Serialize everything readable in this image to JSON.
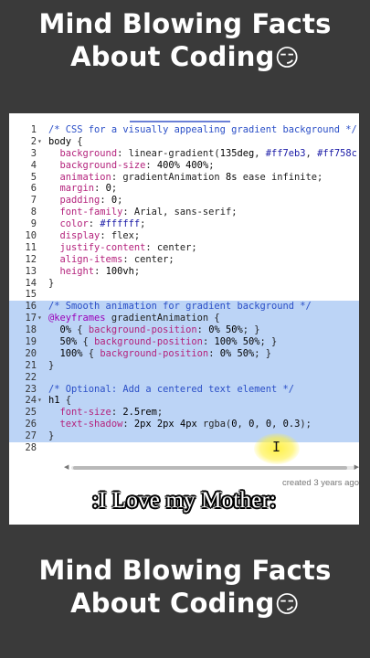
{
  "header": {
    "title_line1": "Mind Blowing Facts",
    "title_line2": "About Coding",
    "emoji": "😏"
  },
  "footer": {
    "title_line1": "Mind Blowing Facts",
    "title_line2": "About Coding",
    "emoji": "😏"
  },
  "editor": {
    "lines": [
      {
        "n": "1",
        "fold": "",
        "sel": false,
        "parts": [
          [
            "c-comment",
            "/* CSS for a visually appealing gradient background */"
          ]
        ]
      },
      {
        "n": "2",
        "fold": "▾",
        "sel": false,
        "parts": [
          [
            "c-sel",
            "body"
          ],
          [
            "c-punc",
            " {"
          ]
        ]
      },
      {
        "n": "3",
        "fold": "",
        "sel": false,
        "parts": [
          [
            "c-punc",
            "  "
          ],
          [
            "c-prop",
            "background"
          ],
          [
            "c-punc",
            ": linear-gradient("
          ],
          [
            "c-num",
            "135deg"
          ],
          [
            "c-punc",
            ", "
          ],
          [
            "c-str",
            "#ff7eb3"
          ],
          [
            "c-punc",
            ", "
          ],
          [
            "c-str",
            "#ff758c"
          ],
          [
            "c-punc",
            ","
          ]
        ]
      },
      {
        "n": "4",
        "fold": "",
        "sel": false,
        "parts": [
          [
            "c-punc",
            "  "
          ],
          [
            "c-prop",
            "background-size"
          ],
          [
            "c-punc",
            ": "
          ],
          [
            "c-num",
            "400%"
          ],
          [
            "c-punc",
            " "
          ],
          [
            "c-num",
            "400%"
          ],
          [
            "c-punc",
            ";"
          ]
        ]
      },
      {
        "n": "5",
        "fold": "",
        "sel": false,
        "parts": [
          [
            "c-punc",
            "  "
          ],
          [
            "c-prop",
            "animation"
          ],
          [
            "c-punc",
            ": gradientAnimation "
          ],
          [
            "c-num",
            "8s"
          ],
          [
            "c-punc",
            " ease infinite;"
          ]
        ]
      },
      {
        "n": "6",
        "fold": "",
        "sel": false,
        "parts": [
          [
            "c-punc",
            "  "
          ],
          [
            "c-prop",
            "margin"
          ],
          [
            "c-punc",
            ": "
          ],
          [
            "c-num",
            "0"
          ],
          [
            "c-punc",
            ";"
          ]
        ]
      },
      {
        "n": "7",
        "fold": "",
        "sel": false,
        "parts": [
          [
            "c-punc",
            "  "
          ],
          [
            "c-prop",
            "padding"
          ],
          [
            "c-punc",
            ": "
          ],
          [
            "c-num",
            "0"
          ],
          [
            "c-punc",
            ";"
          ]
        ]
      },
      {
        "n": "8",
        "fold": "",
        "sel": false,
        "parts": [
          [
            "c-punc",
            "  "
          ],
          [
            "c-prop",
            "font-family"
          ],
          [
            "c-punc",
            ": Arial, sans-serif;"
          ]
        ]
      },
      {
        "n": "9",
        "fold": "",
        "sel": false,
        "parts": [
          [
            "c-punc",
            "  "
          ],
          [
            "c-prop",
            "color"
          ],
          [
            "c-punc",
            ": "
          ],
          [
            "c-str",
            "#ffffff"
          ],
          [
            "c-punc",
            ";"
          ]
        ]
      },
      {
        "n": "10",
        "fold": "",
        "sel": false,
        "parts": [
          [
            "c-punc",
            "  "
          ],
          [
            "c-prop",
            "display"
          ],
          [
            "c-punc",
            ": flex;"
          ]
        ]
      },
      {
        "n": "11",
        "fold": "",
        "sel": false,
        "parts": [
          [
            "c-punc",
            "  "
          ],
          [
            "c-prop",
            "justify-content"
          ],
          [
            "c-punc",
            ": center;"
          ]
        ]
      },
      {
        "n": "12",
        "fold": "",
        "sel": false,
        "parts": [
          [
            "c-punc",
            "  "
          ],
          [
            "c-prop",
            "align-items"
          ],
          [
            "c-punc",
            ": center;"
          ]
        ]
      },
      {
        "n": "13",
        "fold": "",
        "sel": false,
        "parts": [
          [
            "c-punc",
            "  "
          ],
          [
            "c-prop",
            "height"
          ],
          [
            "c-punc",
            ": "
          ],
          [
            "c-num",
            "100vh"
          ],
          [
            "c-punc",
            ";"
          ]
        ]
      },
      {
        "n": "14",
        "fold": "",
        "sel": false,
        "parts": [
          [
            "c-punc",
            "}"
          ]
        ]
      },
      {
        "n": "15",
        "fold": "",
        "sel": false,
        "parts": []
      },
      {
        "n": "16",
        "fold": "",
        "sel": true,
        "parts": [
          [
            "c-comment",
            "/* Smooth animation for gradient background */"
          ]
        ]
      },
      {
        "n": "17",
        "fold": "▾",
        "sel": true,
        "parts": [
          [
            "c-kw",
            "@keyframes"
          ],
          [
            "c-punc",
            " gradientAnimation {"
          ]
        ]
      },
      {
        "n": "18",
        "fold": "",
        "sel": true,
        "parts": [
          [
            "c-punc",
            "  "
          ],
          [
            "c-num",
            "0%"
          ],
          [
            "c-punc",
            " { "
          ],
          [
            "c-prop",
            "background-position"
          ],
          [
            "c-punc",
            ": "
          ],
          [
            "c-num",
            "0%"
          ],
          [
            "c-punc",
            " "
          ],
          [
            "c-num",
            "50%"
          ],
          [
            "c-punc",
            "; }"
          ]
        ]
      },
      {
        "n": "19",
        "fold": "",
        "sel": true,
        "parts": [
          [
            "c-punc",
            "  "
          ],
          [
            "c-num",
            "50%"
          ],
          [
            "c-punc",
            " { "
          ],
          [
            "c-prop",
            "background-position"
          ],
          [
            "c-punc",
            ": "
          ],
          [
            "c-num",
            "100%"
          ],
          [
            "c-punc",
            " "
          ],
          [
            "c-num",
            "50%"
          ],
          [
            "c-punc",
            "; }"
          ]
        ]
      },
      {
        "n": "20",
        "fold": "",
        "sel": true,
        "parts": [
          [
            "c-punc",
            "  "
          ],
          [
            "c-num",
            "100%"
          ],
          [
            "c-punc",
            " { "
          ],
          [
            "c-prop",
            "background-position"
          ],
          [
            "c-punc",
            ": "
          ],
          [
            "c-num",
            "0%"
          ],
          [
            "c-punc",
            " "
          ],
          [
            "c-num",
            "50%"
          ],
          [
            "c-punc",
            "; }"
          ]
        ]
      },
      {
        "n": "21",
        "fold": "",
        "sel": true,
        "parts": [
          [
            "c-punc",
            "}"
          ]
        ]
      },
      {
        "n": "22",
        "fold": "",
        "sel": true,
        "parts": []
      },
      {
        "n": "23",
        "fold": "",
        "sel": true,
        "parts": [
          [
            "c-comment",
            "/* Optional: Add a centered text element */"
          ]
        ]
      },
      {
        "n": "24",
        "fold": "▾",
        "sel": true,
        "parts": [
          [
            "c-sel",
            "h1"
          ],
          [
            "c-punc",
            " {"
          ]
        ]
      },
      {
        "n": "25",
        "fold": "",
        "sel": true,
        "parts": [
          [
            "c-punc",
            "  "
          ],
          [
            "c-prop",
            "font-size"
          ],
          [
            "c-punc",
            ": "
          ],
          [
            "c-num",
            "2.5rem"
          ],
          [
            "c-punc",
            ";"
          ]
        ]
      },
      {
        "n": "26",
        "fold": "",
        "sel": true,
        "parts": [
          [
            "c-punc",
            "  "
          ],
          [
            "c-prop",
            "text-shadow"
          ],
          [
            "c-punc",
            ": "
          ],
          [
            "c-num",
            "2px"
          ],
          [
            "c-punc",
            " "
          ],
          [
            "c-num",
            "2px"
          ],
          [
            "c-punc",
            " "
          ],
          [
            "c-num",
            "4px"
          ],
          [
            "c-punc",
            " rgba("
          ],
          [
            "c-num",
            "0"
          ],
          [
            "c-punc",
            ", "
          ],
          [
            "c-num",
            "0"
          ],
          [
            "c-punc",
            ", "
          ],
          [
            "c-num",
            "0"
          ],
          [
            "c-punc",
            ", "
          ],
          [
            "c-num",
            "0.3"
          ],
          [
            "c-punc",
            ");"
          ]
        ]
      },
      {
        "n": "27",
        "fold": "",
        "sel": true,
        "parts": [
          [
            "c-punc",
            "}"
          ]
        ]
      },
      {
        "n": "28",
        "fold": "",
        "sel": false,
        "parts": []
      }
    ],
    "created_text": "created 3 years ago"
  },
  "caption": ":I Love my Mother:",
  "colors": {
    "selection": "#bcd4f6",
    "comment": "#2b4fc7",
    "property": "#b4227c",
    "keyword": "#9a00b8",
    "background": "#3a3a3a"
  }
}
